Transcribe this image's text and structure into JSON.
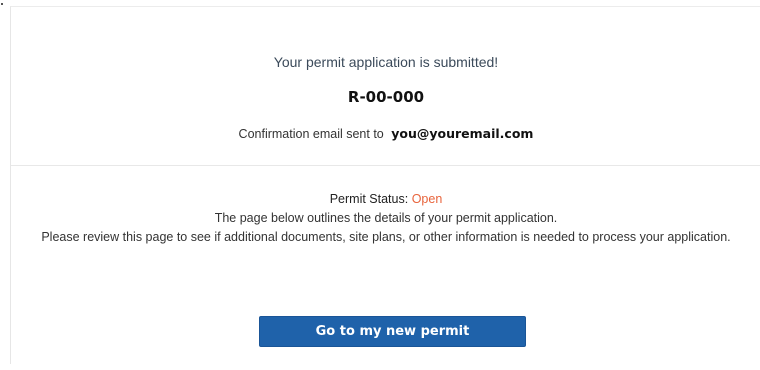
{
  "confirmation": {
    "title": "Your permit application is submitted!",
    "permit_number": "R-00-000",
    "email_prefix": "Confirmation email sent to",
    "email": "you@youremail.com"
  },
  "status": {
    "label": "Permit Status:",
    "value": "Open",
    "value_color": "#e8643c",
    "line1": "The page below outlines the details of your permit application.",
    "line2": "Please review this page to see if additional documents, site plans, or other information is needed to process your application."
  },
  "actions": {
    "go_to_permit_label": "Go to my new permit",
    "button_color": "#1f62aa"
  }
}
